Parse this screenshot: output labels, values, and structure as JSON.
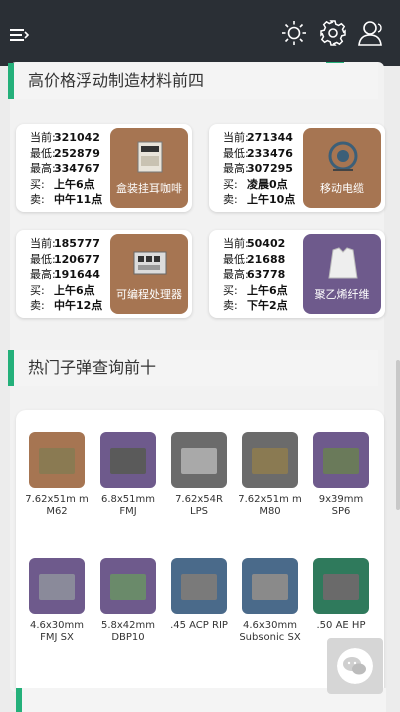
{
  "topbar": {
    "icons": [
      "menu-icon",
      "sun-icon",
      "gear-icon",
      "user-icon"
    ]
  },
  "materials": {
    "title": "高价格浮动制造材料前四",
    "labels": {
      "current": "当前:",
      "low": "最低:",
      "high": "最高:",
      "buy": "买:",
      "sell": "卖:"
    },
    "items": [
      {
        "name": "盒装挂耳咖啡",
        "current": "321042",
        "low": "252879",
        "high": "334767",
        "buy": "上午6点",
        "sell": "中午11点",
        "color": "#a67552"
      },
      {
        "name": "移动电缆",
        "current": "271344",
        "low": "233476",
        "high": "307295",
        "buy": "凌晨0点",
        "sell": "上午10点",
        "color": "#a67552"
      },
      {
        "name": "可编程处理器",
        "current": "185777",
        "low": "120677",
        "high": "191644",
        "buy": "上午6点",
        "sell": "中午12点",
        "color": "#a67552"
      },
      {
        "name": "聚乙烯纤维",
        "current": "50402",
        "low": "21688",
        "high": "63778",
        "buy": "上午6点",
        "sell": "下午2点",
        "color": "#6e5a8c"
      }
    ]
  },
  "bullets": {
    "title": "热门子弹查询前十",
    "items": [
      {
        "name": "7.62x51m m M62",
        "color": "#a67552"
      },
      {
        "name": "6.8x51mm FMJ",
        "color": "#6e5a8c"
      },
      {
        "name": "7.62x54R LPS",
        "color": "#6b6b6b"
      },
      {
        "name": "7.62x51m m M80",
        "color": "#6b6b6b"
      },
      {
        "name": "9x39mm SP6",
        "color": "#6e5a8c"
      },
      {
        "name": "4.6x30mm FMJ SX",
        "color": "#6e5a8c"
      },
      {
        "name": "5.8x42mm DBP10",
        "color": "#6e5a8c"
      },
      {
        "name": ".45 ACP RIP",
        "color": "#4a6a8a"
      },
      {
        "name": "4.6x30mm Subsonic SX",
        "color": "#4a6a8a"
      },
      {
        "name": ".50 AE HP",
        "color": "#2f7a5c"
      }
    ]
  },
  "fab": {
    "icon": "wechat-icon"
  }
}
